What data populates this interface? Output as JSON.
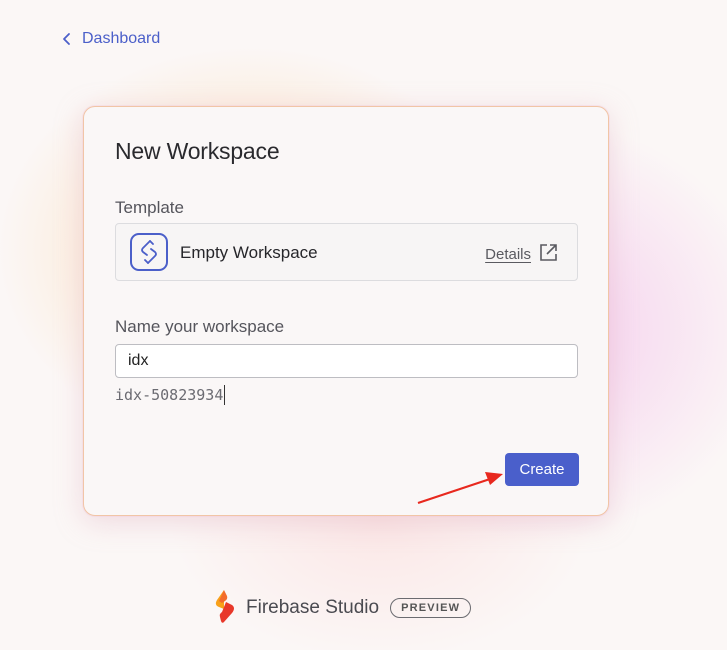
{
  "nav": {
    "back_label": "Dashboard",
    "back_icon": "chevron-left-icon"
  },
  "dialog": {
    "title": "New Workspace",
    "template_label": "Template",
    "template": {
      "icon": "template-logo-icon",
      "name": "Empty Workspace",
      "details_label": "Details",
      "details_icon": "external-link-icon"
    },
    "name_label": "Name your workspace",
    "name_value": "idx",
    "workspace_id": "idx-50823934",
    "create_label": "Create"
  },
  "footer": {
    "brand": "Firebase Studio",
    "badge": "PREVIEW",
    "logo_icon": "firebase-logo-icon"
  },
  "colors": {
    "accent": "#4a5fcb",
    "annotation": "#e8281e"
  }
}
